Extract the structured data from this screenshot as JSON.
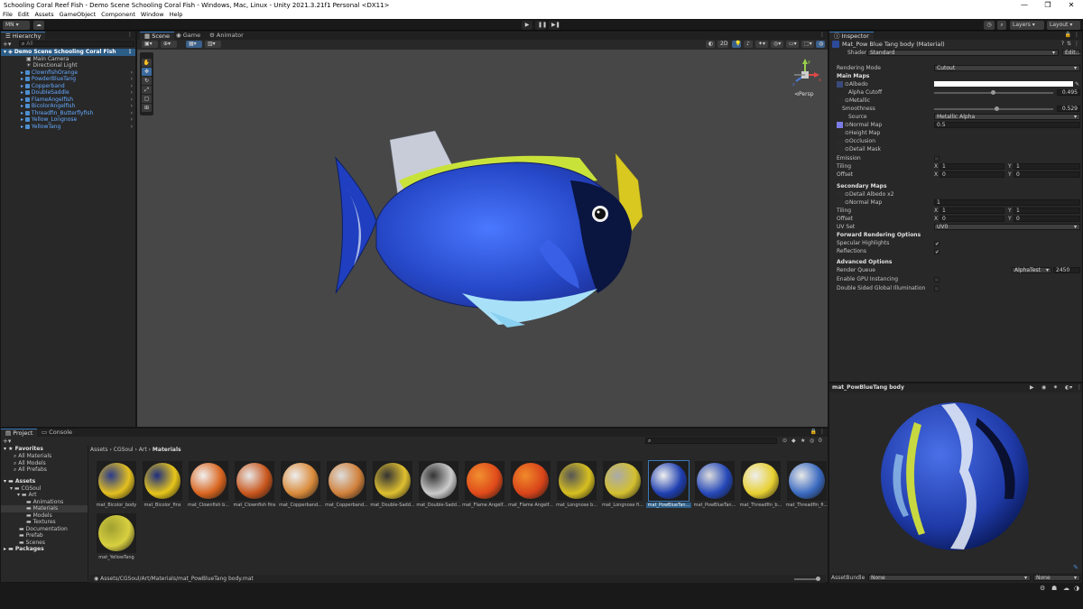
{
  "window": {
    "title": "Schooling Coral Reef Fish - Demo Scene Schooling Coral Fish - Windows, Mac, Linux - Unity 2021.3.21f1 Personal <DX11>",
    "controls": [
      "—",
      "❐",
      "✕"
    ]
  },
  "menu": [
    "File",
    "Edit",
    "Assets",
    "GameObject",
    "Component",
    "Window",
    "Help"
  ],
  "toolbar": {
    "account": "MN",
    "layers": "Layers",
    "layout": "Layout"
  },
  "hierarchy": {
    "tab": "Hierarchy",
    "search_placeholder": "All",
    "scene": "Demo Scene Schooling Coral Fish",
    "items": [
      "Main Camera",
      "Directional Light",
      "ClownfishOrange",
      "PowderBlueTang",
      "Copperband",
      "DoubleSaddle",
      "FlameAngelfish",
      "BicolorAngelfish",
      "Threadfin_Butterflyfish",
      "Yellow_Longnose",
      "YellowTang"
    ]
  },
  "scene": {
    "tabs": [
      "Scene",
      "Game",
      "Animator"
    ],
    "mode_2d": "2D",
    "persp": "Persp",
    "gizmo_axes": [
      "y",
      "x",
      "z"
    ]
  },
  "inspector": {
    "tab": "Inspector",
    "material_name": "Mat_Pow Blue Tang body (Material)",
    "shader_label": "Shader",
    "shader_value": "Standard",
    "edit": "Edit...",
    "rendering_mode_label": "Rendering Mode",
    "rendering_mode_value": "Cutout",
    "main_maps": "Main Maps",
    "albedo": "Albedo",
    "alpha_cutoff": "Alpha Cutoff",
    "alpha_cutoff_value": "0.495",
    "metallic": "Metallic",
    "smoothness": "Smoothness",
    "smoothness_value": "0.529",
    "source": "Source",
    "source_value": "Metallic Alpha",
    "normal_map": "Normal Map",
    "normal_map_value": "0.5",
    "height_map": "Height Map",
    "occlusion": "Occlusion",
    "detail_mask": "Detail Mask",
    "emission": "Emission",
    "tiling": "Tiling",
    "offset": "Offset",
    "tiling_x": "1",
    "tiling_y": "1",
    "offset_x": "0",
    "offset_y": "0",
    "x_label": "X",
    "y_label": "Y",
    "secondary_maps": "Secondary Maps",
    "detail_albedo": "Detail Albedo x2",
    "sec_normal_map": "Normal Map",
    "sec_normal_value": "1",
    "sec_tiling_x": "1",
    "sec_tiling_y": "1",
    "sec_offset_x": "0",
    "sec_offset_y": "0",
    "uv_set": "UV Set",
    "uv_set_value": "UV0",
    "forward_options": "Forward Rendering Options",
    "specular_highlights": "Specular Highlights",
    "reflections": "Reflections",
    "advanced_options": "Advanced Options",
    "render_queue": "Render Queue",
    "render_queue_mode": "AlphaTest",
    "render_queue_value": "2450",
    "gpu_instancing": "Enable GPU Instancing",
    "double_sided_gi": "Double Sided Global Illumination",
    "preview_title": "mat_PowBlueTang body",
    "assetbundle_label": "AssetBundle",
    "assetbundle_value": "None",
    "assetbundle_variant": "None",
    "alpha_cutoff_fraction": 0.495,
    "smoothness_fraction": 0.529
  },
  "project": {
    "tabs": [
      "Project",
      "Console"
    ],
    "favorites": "Favorites",
    "fav_items": [
      "All Materials",
      "All Models",
      "All Prefabs"
    ],
    "assets": "Assets",
    "tree": [
      "CGSoul",
      "Art",
      "Animations",
      "Materials",
      "Models",
      "Textures",
      "Documentation",
      "Prefab",
      "Scenes"
    ],
    "packages": "Packages",
    "breadcrumb": [
      "Assets",
      "CGSoul",
      "Art",
      "Materials"
    ],
    "thumbnails": [
      {
        "label": "mat_Bicolor_body",
        "c1": "#e4c020",
        "c2": "#2a3a8a"
      },
      {
        "label": "mat_Bicolor_fins",
        "c1": "#e8c61a",
        "c2": "#1d2d80"
      },
      {
        "label": "mat_Clownfish b...",
        "c1": "#d9651f",
        "c2": "#f1f1f1"
      },
      {
        "label": "mat_Clownfish fins",
        "c1": "#c8561c",
        "c2": "#e8e8e8"
      },
      {
        "label": "mat_Copperband...",
        "c1": "#d98a3a",
        "c2": "#eeeeee"
      },
      {
        "label": "mat_Copperband...",
        "c1": "#d0803a",
        "c2": "#dddddd"
      },
      {
        "label": "mat_Double-Sadd...",
        "c1": "#e0c030",
        "c2": "#333333"
      },
      {
        "label": "mat_Double-Sadd...",
        "c1": "#cccccc",
        "c2": "#333333"
      },
      {
        "label": "mat_Flame Angelf...",
        "c1": "#e04a1a",
        "c2": "#f09030"
      },
      {
        "label": "mat_Flame Angelf...",
        "c1": "#d8441a",
        "c2": "#f08a2a"
      },
      {
        "label": "mat_Longnose b...",
        "c1": "#d8c020",
        "c2": "#555555"
      },
      {
        "label": "mat_Longnose fi...",
        "c1": "#d4c030",
        "c2": "#aaaaaa"
      },
      {
        "label": "mat_PowBlueTan...",
        "c1": "#1f3fb0",
        "c2": "#f0f0f0"
      },
      {
        "label": "mat_PowBlueTan...",
        "c1": "#2548b8",
        "c2": "#dddddd"
      },
      {
        "label": "mat_Threadfin_b...",
        "c1": "#e8d030",
        "c2": "#eeeeee"
      },
      {
        "label": "mat_Threadfin_fi...",
        "c1": "#3a6ac0",
        "c2": "#e8e8e8"
      },
      {
        "label": "mat_YellowTang",
        "c1": "#d8d040",
        "c2": "#a0a030"
      }
    ],
    "selected_index": 12,
    "status_path": "Assets/CGSoul/Art/Materials/mat_PowBlueTang body.mat",
    "count_badge": "0"
  }
}
